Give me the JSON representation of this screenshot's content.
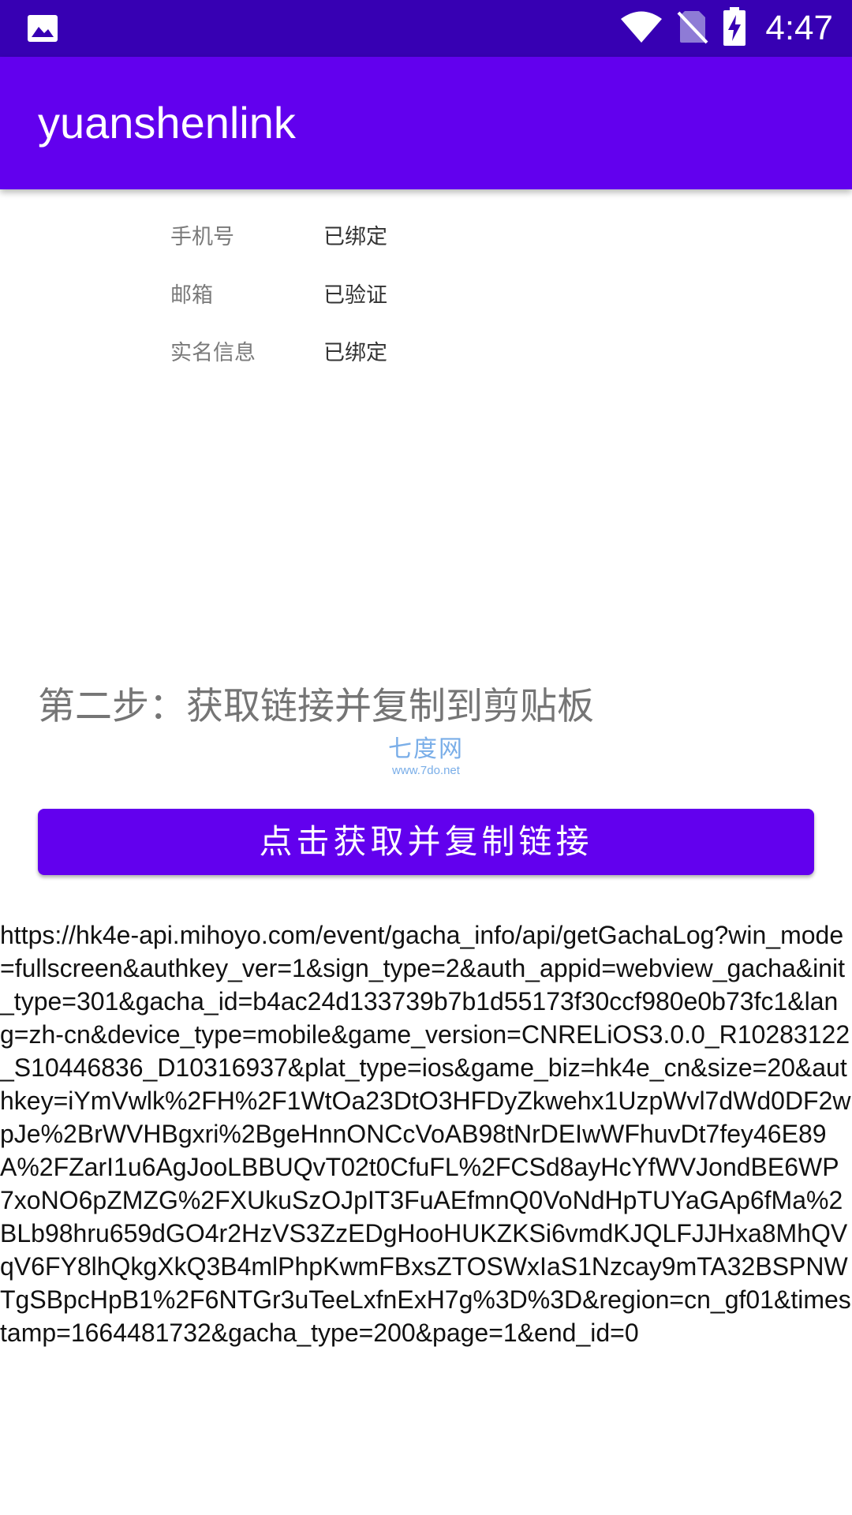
{
  "status_bar": {
    "time": "4:47",
    "left_icon": "image-icon",
    "icons": [
      "wifi-icon",
      "no-sim-icon",
      "battery-charging-icon"
    ]
  },
  "app_bar": {
    "title": "yuanshenlink"
  },
  "info": [
    {
      "label": "手机号",
      "value": "已绑定"
    },
    {
      "label": "邮箱",
      "value": "已验证"
    },
    {
      "label": "实名信息",
      "value": "已绑定"
    }
  ],
  "step": {
    "heading": "第二步：获取链接并复制到剪贴板"
  },
  "watermark": {
    "name": "七度网",
    "url": "www.7do.net"
  },
  "button": {
    "label": "点击获取并复制链接"
  },
  "result": {
    "link": "https://hk4e-api.mihoyo.com/event/gacha_info/api/getGachaLog?win_mode=fullscreen&authkey_ver=1&sign_type=2&auth_appid=webview_gacha&init_type=301&gacha_id=b4ac24d133739b7b1d55173f30ccf980e0b73fc1&lang=zh-cn&device_type=mobile&game_version=CNRELiOS3.0.0_R10283122_S10446836_D10316937&plat_type=ios&game_biz=hk4e_cn&size=20&authkey=iYmVwlk%2FH%2F1WtOa23DtO3HFDyZkwehx1UzpWvl7dWd0DF2wpJe%2BrWVHBgxri%2BgeHnnONCcVoAB98tNrDEIwWFhuvDt7fey46E89A%2FZarI1u6AgJooLBBUQvT02t0CfuFL%2FCSd8ayHcYfWVJondBE6WP7xoNO6pZMZG%2FXUkuSzOJpIT3FuAEfmnQ0VoNdHpTUYaGAp6fMa%2BLb98hru659dGO4r2HzVS3ZzEDgHooHUKZKSi6vmdKJQLFJJHxa8MhQVqV6FY8lhQkgXkQ3B4mlPhpKwmFBxsZTOSWxIaS1Nzcay9mTA32BSPNWTgSBpcHpB1%2F6NTGr3uTeeLxfnExH7g%3D%3D&region=cn_gf01&timestamp=1664481732&gacha_type=200&page=1&end_id=0"
  },
  "colors": {
    "status_bar": "#3700b3",
    "primary": "#6200ee",
    "label": "#7a7a7a",
    "heading": "#757575",
    "watermark": "#7aaee8"
  }
}
